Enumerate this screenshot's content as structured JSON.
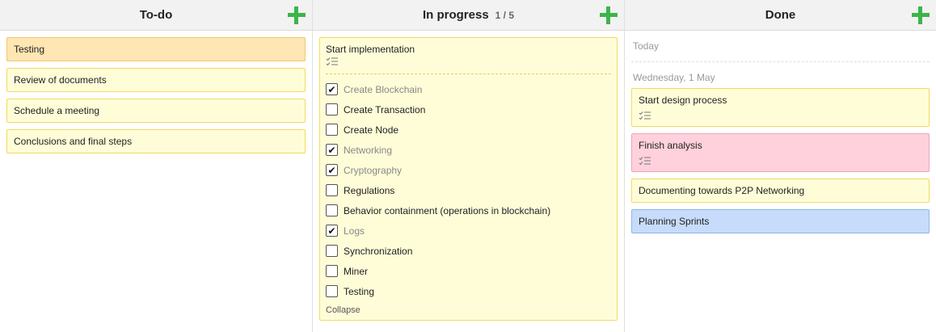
{
  "columns": {
    "todo": {
      "title": "To-do",
      "cards": [
        "Testing",
        "Review of documents",
        "Schedule a meeting",
        "Conclusions and final steps"
      ]
    },
    "progress": {
      "title": "In progress",
      "count": "1 / 5",
      "card": {
        "title": "Start implementation",
        "collapse_label": "Collapse",
        "items": [
          {
            "label": "Create Blockchain",
            "checked": true
          },
          {
            "label": "Create Transaction",
            "checked": false
          },
          {
            "label": "Create Node",
            "checked": false
          },
          {
            "label": "Networking",
            "checked": true
          },
          {
            "label": "Cryptography",
            "checked": true
          },
          {
            "label": "Regulations",
            "checked": false
          },
          {
            "label": "Behavior containment (operations in blockchain)",
            "checked": false
          },
          {
            "label": "Logs",
            "checked": true
          },
          {
            "label": "Synchronization",
            "checked": false
          },
          {
            "label": "Miner",
            "checked": false
          },
          {
            "label": "Testing",
            "checked": false
          }
        ]
      }
    },
    "done": {
      "title": "Done",
      "today_label": "Today",
      "date_label": "Wednesday, 1 May",
      "cards": [
        "Start design process",
        "Finish analysis",
        "Documenting towards P2P Networking",
        "Planning Sprints"
      ]
    }
  },
  "icons": {
    "add": "plus-icon",
    "checklist": "checklist-icon"
  },
  "colors": {
    "add_green": "#3cb54a",
    "card_yellow": "#fffdd8",
    "card_orange": "#ffe6b2",
    "card_pink": "#ffd1dc",
    "card_blue": "#c6dcfa"
  }
}
